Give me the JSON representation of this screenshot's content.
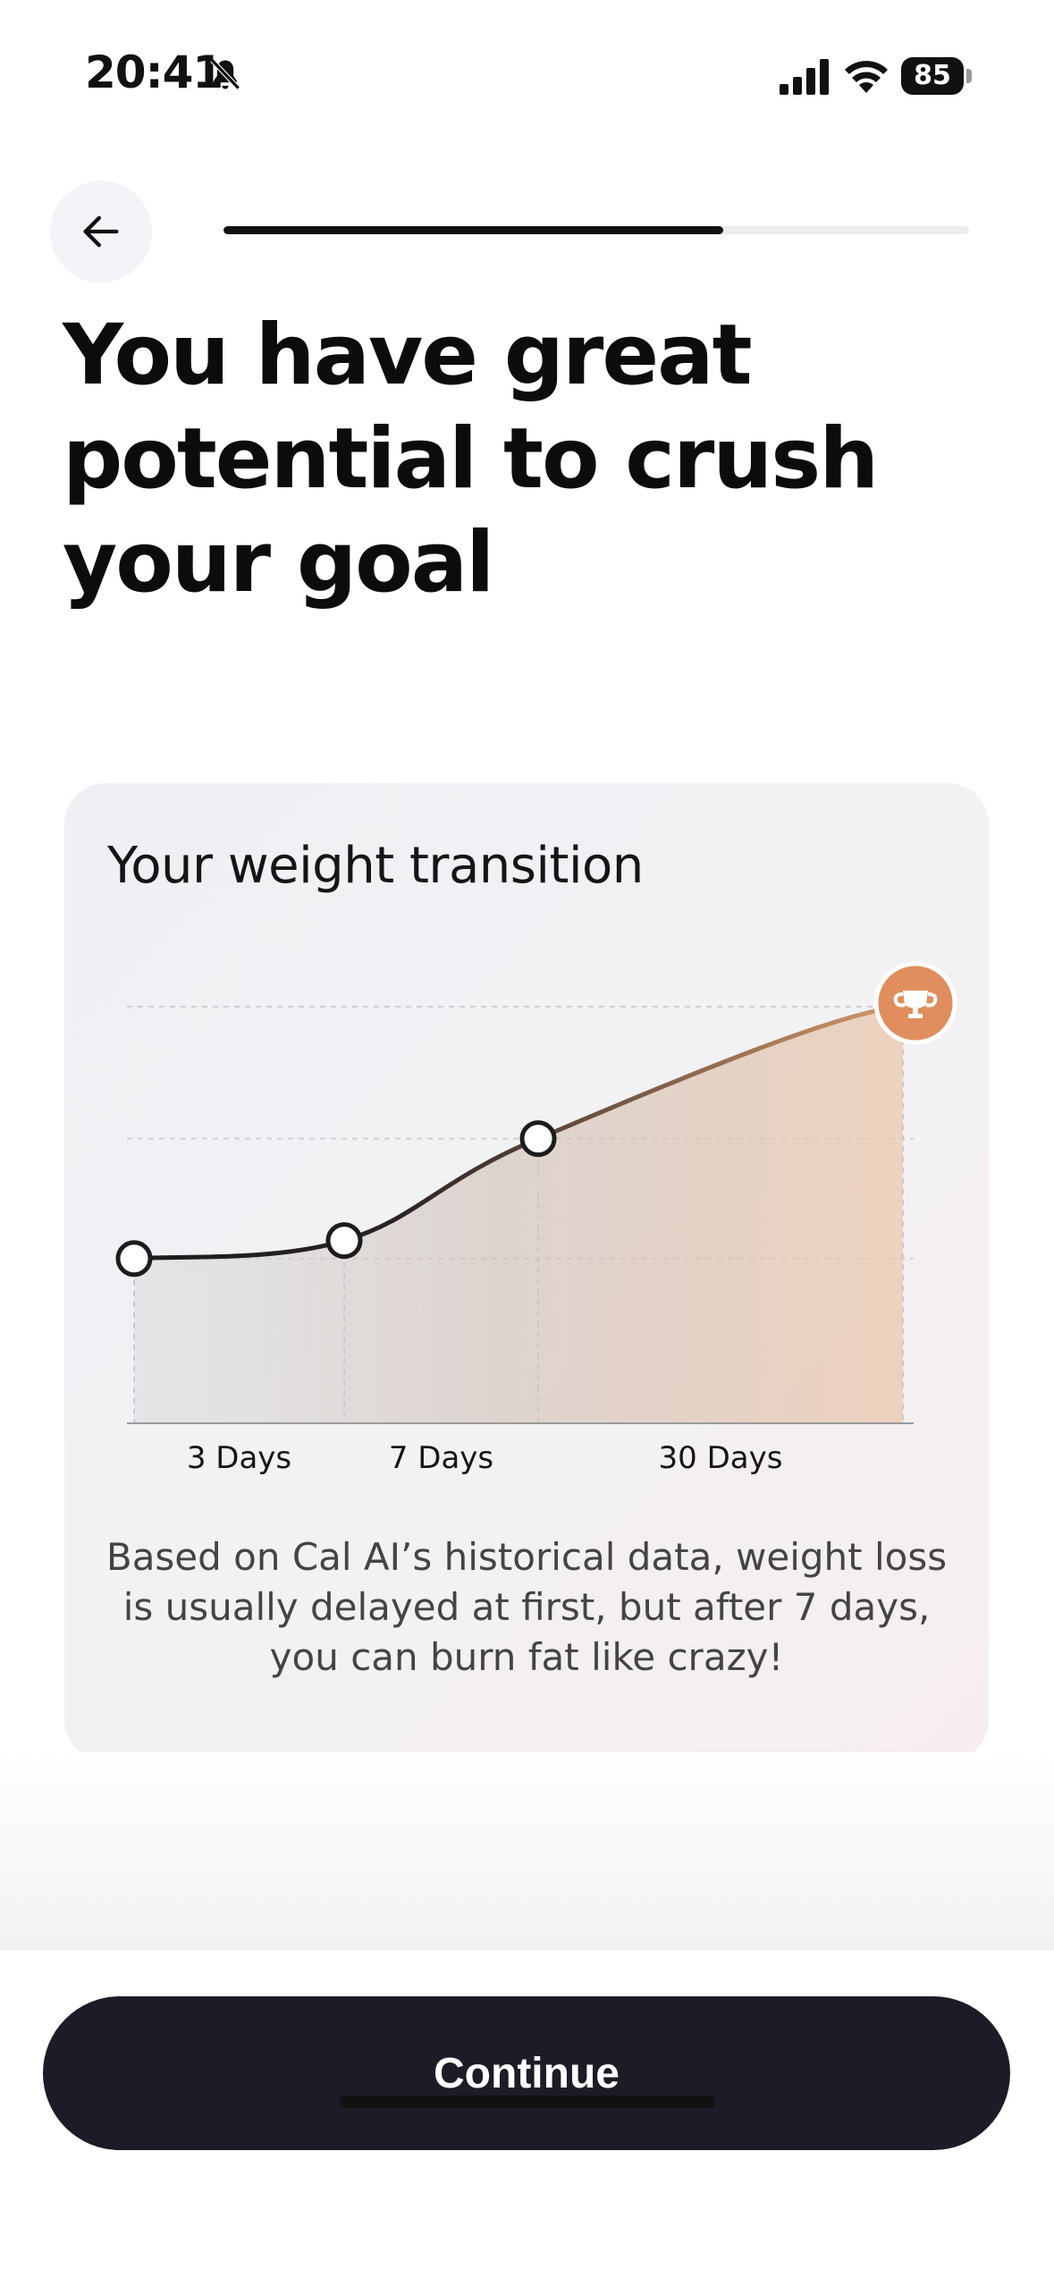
{
  "status_bar": {
    "time": "20:41",
    "battery": "85",
    "icons": [
      "bell-slash-icon",
      "cellular-signal-icon",
      "wifi-icon",
      "battery-icon"
    ]
  },
  "nav": {
    "back_icon": "arrow-left-icon",
    "progress_fraction": 0.67
  },
  "title": "You have great potential to crush your goal",
  "card": {
    "title": "Your weight transition",
    "caption": "Based on Cal AI’s historical data, weight loss is usually delayed at first, but after 7 days, you can burn fat like crazy!"
  },
  "chart_data": {
    "type": "area",
    "title": "Your weight transition",
    "x_labels": [
      "3 Days",
      "7 Days",
      "30 Days"
    ],
    "points": [
      {
        "x": 0,
        "y": 1.0
      },
      {
        "x": 1,
        "y": 1.15
      },
      {
        "x": 2,
        "y": 2.0
      },
      {
        "x": 3,
        "y": 3.1
      }
    ],
    "ylim": [
      0,
      3.1
    ],
    "grid": true,
    "end_marker_icon": "trophy-icon",
    "colors": {
      "line_start": "#1c1c1c",
      "line_end": "#d49a6a",
      "accent": "#e08e5e"
    }
  },
  "footer": {
    "continue_label": "Continue"
  },
  "colors": {
    "button_bg": "#1d1b25",
    "accent": "#e08e5e"
  }
}
